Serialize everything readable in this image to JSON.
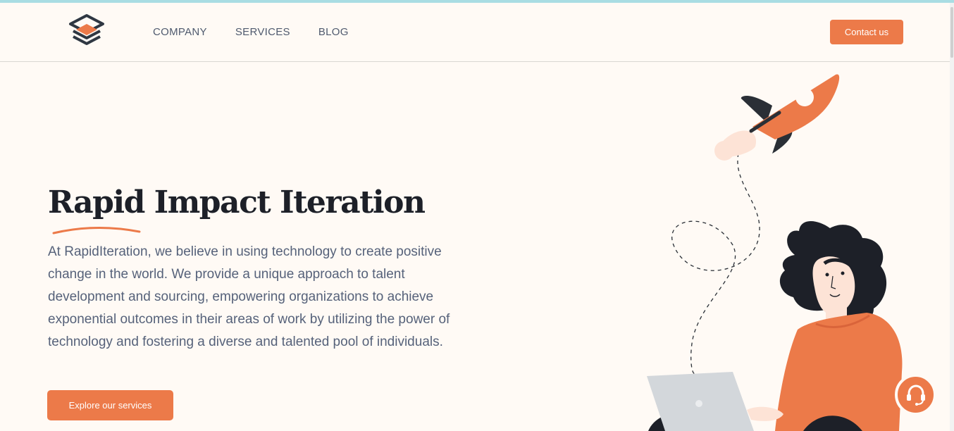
{
  "header": {
    "logo_icon": "stacked-layers-icon",
    "nav": [
      "COMPANY",
      "SERVICES",
      "BLOG"
    ],
    "contact_label": "Contact us"
  },
  "hero": {
    "title": "Rapid Impact Iteration",
    "text": "At RapidIteration, we believe in using technology to create positive change in the world. We provide a unique approach to talent development and sourcing, empowering organizations to achieve exponential outcomes in their areas of work by utilizing the power of technology and fostering a diverse and talented pool of individuals.",
    "cta_label": "Explore our services"
  },
  "illustration": {
    "icons": [
      "rocket-icon",
      "woman-with-laptop-illustration"
    ]
  },
  "support": {
    "icon": "headset-icon"
  },
  "colors": {
    "accent": "#ec7a49",
    "dark": "#1d2028",
    "text": "#56627a",
    "nav": "#4f5a6e",
    "background": "#fffaf5"
  }
}
